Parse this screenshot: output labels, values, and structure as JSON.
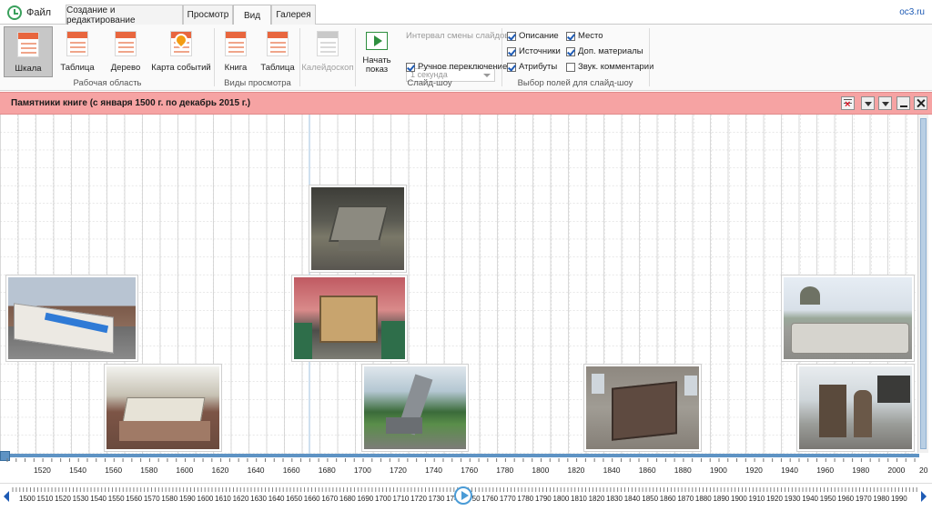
{
  "tabs": {
    "file": "Файл",
    "items": [
      "Создание и редактирование",
      "Просмотр",
      "Вид",
      "Галерея"
    ],
    "active": "Вид"
  },
  "brand": "oc3.ru",
  "ribbon": {
    "workspace": {
      "buttons": [
        "Шкала",
        "Таблица",
        "Дерево",
        "Карта событий"
      ],
      "selected": "Шкала",
      "label": "Рабочая область"
    },
    "views": {
      "buttons": [
        "Книга",
        "Таблица"
      ],
      "label": "Виды просмотра"
    },
    "kaleidoscope": "Калейдоскоп",
    "slideshow": {
      "start_line1": "Начать",
      "start_line2": "показ",
      "interval_label": "Интервал смены слайдов",
      "interval_value": "1 секунда",
      "manual_label": "Ручное переключение",
      "manual_checked": true,
      "label": "Слайд-шоу"
    },
    "fields": {
      "label": "Выбор полей для слайд-шоу",
      "items": [
        {
          "label": "Описание",
          "checked": true
        },
        {
          "label": "Источники",
          "checked": true
        },
        {
          "label": "Атрибуты",
          "checked": true
        },
        {
          "label": "Место",
          "checked": true
        },
        {
          "label": "Доп. материалы",
          "checked": true
        },
        {
          "label": "Звук. комментарии",
          "checked": false
        }
      ]
    }
  },
  "timeline": {
    "title": "Памятники книге (с января 1500 г. по декабрь 2015 г.)",
    "ruler_years": [
      "1520",
      "1540",
      "1560",
      "1580",
      "1600",
      "1620",
      "1640",
      "1660",
      "1680",
      "1700",
      "1720",
      "1740",
      "1760",
      "1780",
      "1800",
      "1820",
      "1840",
      "1860",
      "1880",
      "1900",
      "1920",
      "1940",
      "1960",
      "1980",
      "2000",
      "20"
    ],
    "overview_years": [
      "1500",
      "1510",
      "1520",
      "1530",
      "1540",
      "1550",
      "1560",
      "1570",
      "1580",
      "1590",
      "1600",
      "1610",
      "1620",
      "1630",
      "1640",
      "1650",
      "1660",
      "1670",
      "1680",
      "1690",
      "1700",
      "1710",
      "1720",
      "1730",
      "1740",
      "1750",
      "1760",
      "1770",
      "1780",
      "1790",
      "1800",
      "1810",
      "1820",
      "1830",
      "1840",
      "1850",
      "1860",
      "1870",
      "1880",
      "1890",
      "1900",
      "1910",
      "1920",
      "1930",
      "1940",
      "1950",
      "1960",
      "1970",
      "1980",
      "1990"
    ],
    "colors": {
      "header_bg": "#f6a3a3",
      "ruler_accent": "#5e93c4",
      "brand_link": "#1e5bb5"
    }
  }
}
